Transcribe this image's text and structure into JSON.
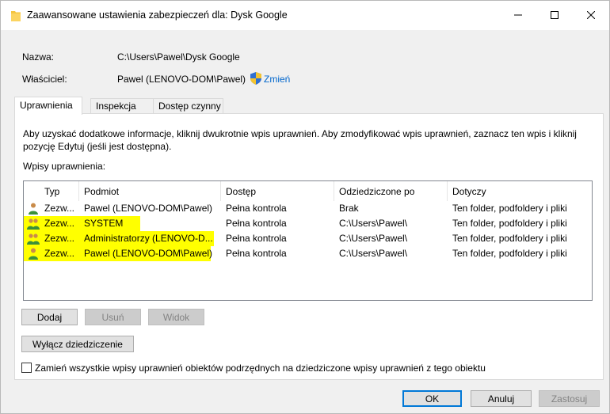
{
  "window": {
    "title": "Zaawansowane ustawienia zabezpieczeń dla: Dysk Google"
  },
  "info": {
    "name_label": "Nazwa:",
    "name_value": "C:\\Users\\Pawel\\Dysk Google",
    "owner_label": "Właściciel:",
    "owner_value": "Pawel (LENOVO-DOM\\Pawel)",
    "change_link": "Zmień"
  },
  "tabs": [
    {
      "label": "Uprawnienia"
    },
    {
      "label": "Inspekcja"
    },
    {
      "label": "Dostęp czynny"
    }
  ],
  "permissions": {
    "description": "Aby uzyskać dodatkowe informacje, kliknij dwukrotnie wpis uprawnień. Aby zmodyfikować wpis uprawnień, zaznacz ten wpis i kliknij pozycję Edytuj (jeśli jest dostępna).",
    "list_label": "Wpisy uprawnienia:",
    "columns": [
      "Typ",
      "Podmiot",
      "Dostęp",
      "Odziedziczone po",
      "Dotyczy"
    ],
    "rows": [
      {
        "type": "Zezw...",
        "principal": "Pawel (LENOVO-DOM\\Pawel)",
        "access": "Pełna kontrola",
        "inherited": "Brak",
        "applies": "Ten folder, podfoldery i pliki"
      },
      {
        "type": "Zezw...",
        "principal": "SYSTEM",
        "access": "Pełna kontrola",
        "inherited": "C:\\Users\\Pawel\\",
        "applies": "Ten folder, podfoldery i pliki"
      },
      {
        "type": "Zezw...",
        "principal": "Administratorzy (LENOVO-D...",
        "access": "Pełna kontrola",
        "inherited": "C:\\Users\\Pawel\\",
        "applies": "Ten folder, podfoldery i pliki"
      },
      {
        "type": "Zezw...",
        "principal": "Pawel (LENOVO-DOM\\Pawel)",
        "access": "Pełna kontrola",
        "inherited": "C:\\Users\\Pawel\\",
        "applies": "Ten folder, podfoldery i pliki"
      }
    ],
    "add_button": "Dodaj",
    "remove_button": "Usuń",
    "view_button": "Widok",
    "disable_inheritance_button": "Wyłącz dziedziczenie",
    "replace_checkbox_label": "Zamień wszystkie wpisy uprawnień obiektów podrzędnych na dziedziczone wpisy uprawnień z tego obiektu"
  },
  "footer": {
    "ok": "OK",
    "cancel": "Anuluj",
    "apply": "Zastosuj"
  },
  "colors": {
    "highlight": "#ffff00",
    "link": "#0066cc",
    "accent": "#0078d7"
  }
}
